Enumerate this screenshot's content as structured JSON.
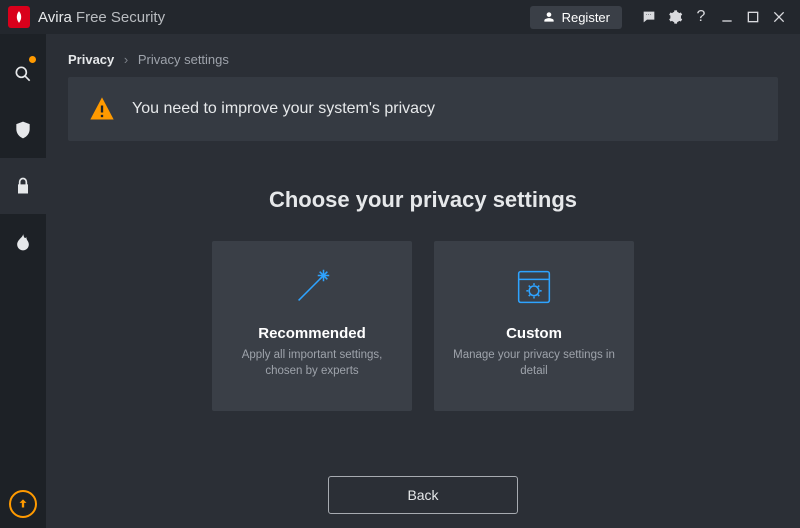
{
  "titlebar": {
    "brand": "Avira",
    "product": "Free Security",
    "register_label": "Register"
  },
  "breadcrumb": {
    "root": "Privacy",
    "current": "Privacy settings"
  },
  "alert": {
    "message": "You need to improve your system's privacy"
  },
  "heading": "Choose your privacy settings",
  "cards": {
    "recommended": {
      "title": "Recommended",
      "desc": "Apply all important settings, chosen by experts"
    },
    "custom": {
      "title": "Custom",
      "desc": "Manage your privacy settings in detail"
    }
  },
  "buttons": {
    "back": "Back"
  },
  "sidebar": {
    "items": [
      "status",
      "security",
      "privacy",
      "performance"
    ]
  }
}
